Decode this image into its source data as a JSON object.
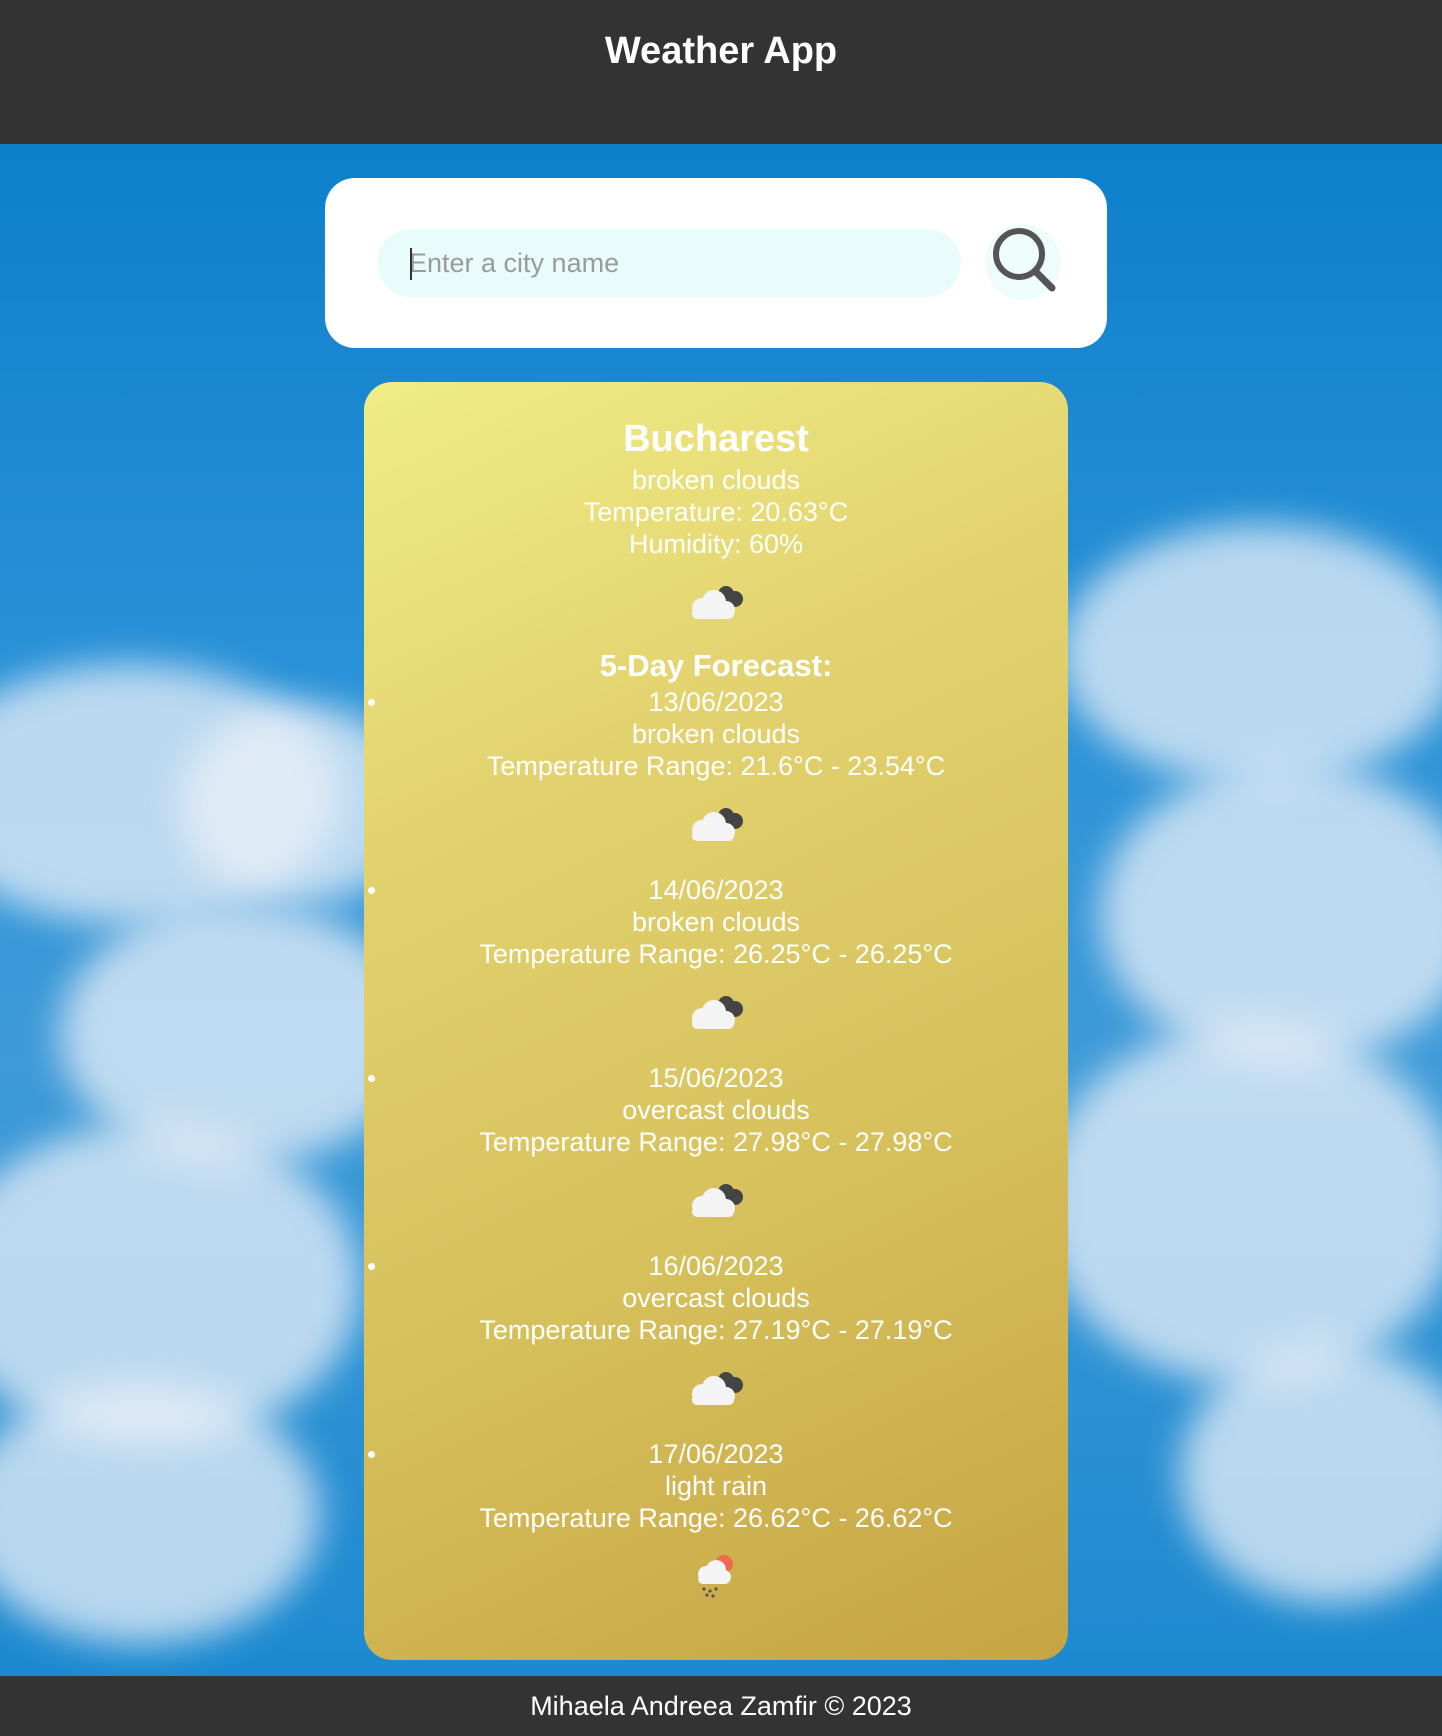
{
  "header": {
    "title": "Weather App"
  },
  "search": {
    "placeholder": "Enter a city name",
    "value": ""
  },
  "current": {
    "city": "Bucharest",
    "description": "broken clouds",
    "temperature": "Temperature: 20.63°C",
    "humidity": "Humidity: 60%",
    "icon": "broken-clouds-icon"
  },
  "forecast": {
    "title": "5-Day Forecast:",
    "days": [
      {
        "date": "13/06/2023",
        "description": "broken clouds",
        "range": "Temperature Range: 21.6°C - 23.54°C",
        "icon": "broken-clouds-icon"
      },
      {
        "date": "14/06/2023",
        "description": "broken clouds",
        "range": "Temperature Range: 26.25°C - 26.25°C",
        "icon": "broken-clouds-icon"
      },
      {
        "date": "15/06/2023",
        "description": "overcast clouds",
        "range": "Temperature Range: 27.98°C - 27.98°C",
        "icon": "overcast-clouds-icon"
      },
      {
        "date": "16/06/2023",
        "description": "overcast clouds",
        "range": "Temperature Range: 27.19°C - 27.19°C",
        "icon": "overcast-clouds-icon"
      },
      {
        "date": "17/06/2023",
        "description": "light rain",
        "range": "Temperature Range: 26.62°C - 26.62°C",
        "icon": "light-rain-icon"
      }
    ]
  },
  "footer": {
    "text": "Mihaela Andreea Zamfir © 2023"
  },
  "colors": {
    "header_bg": "#333333",
    "card_gradient_start": "#f0ed85",
    "card_gradient_end": "#c6a443",
    "search_field_bg": "#e8fdfb"
  }
}
